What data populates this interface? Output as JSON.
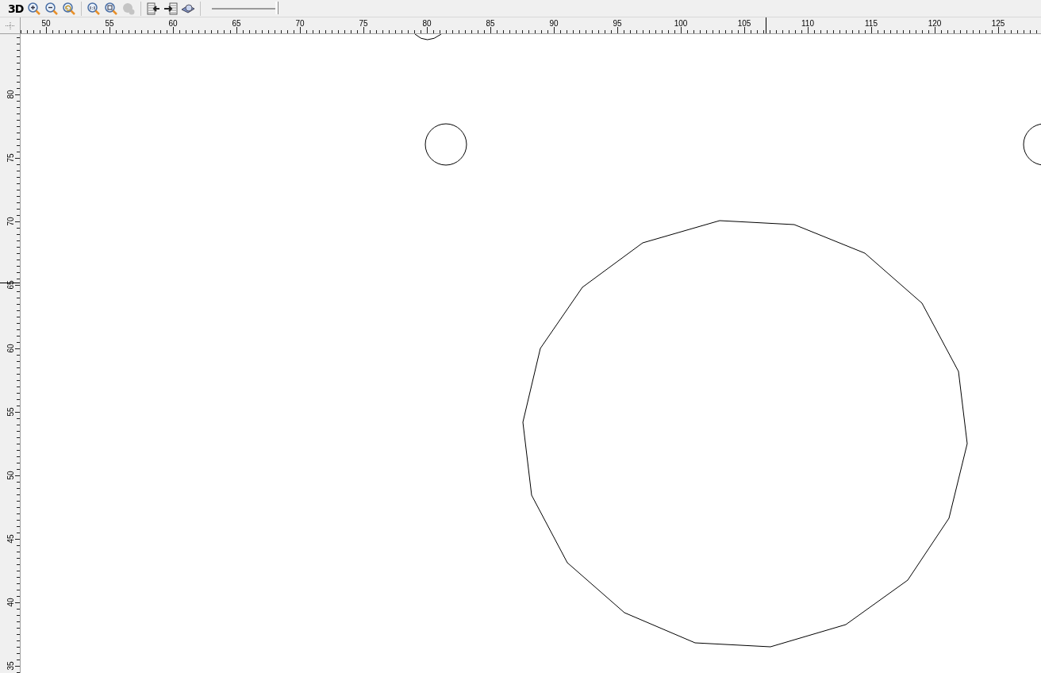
{
  "toolbar": {
    "view_label": "3D",
    "groups": [
      [
        {
          "kind": "zoom-in",
          "disabled": false
        },
        {
          "kind": "zoom-out",
          "disabled": false
        },
        {
          "kind": "zoom-reset",
          "disabled": false
        }
      ],
      [
        {
          "kind": "zoom-actual",
          "disabled": false
        },
        {
          "kind": "zoom-fit",
          "disabled": false
        },
        {
          "kind": "zoom-selection",
          "disabled": true
        }
      ],
      [
        {
          "kind": "import",
          "disabled": false
        },
        {
          "kind": "export",
          "disabled": false
        },
        {
          "kind": "preview",
          "disabled": false
        }
      ]
    ],
    "zoom_slider": {
      "level": 1.0
    }
  },
  "horizontal_ruler": {
    "labels": [
      "50",
      "55",
      "60",
      "65",
      "70",
      "75",
      "80",
      "85",
      "90",
      "95",
      "100",
      "105",
      "110",
      "115",
      "120",
      "125"
    ]
  },
  "vertical_ruler": {
    "labels": [
      "80",
      "75",
      "70",
      "65",
      "60",
      "55",
      "50",
      "45",
      "40",
      "35"
    ]
  }
}
